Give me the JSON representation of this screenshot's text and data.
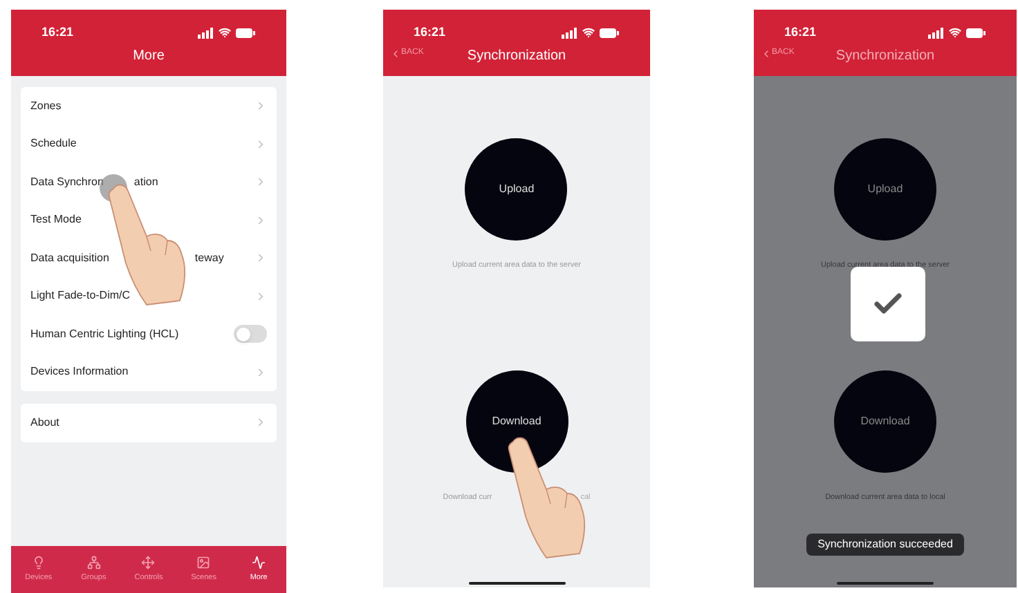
{
  "screens": [
    {
      "kind": "menu",
      "time": "16:21",
      "title": "More",
      "touch_hint": true,
      "sections": [
        {
          "rows": [
            {
              "kind": "link",
              "label": "Zones"
            },
            {
              "kind": "link",
              "label": "Schedule"
            },
            {
              "kind": "link",
              "label": "Data Synchron",
              "label_end": "ation"
            },
            {
              "kind": "link",
              "label": "Test Mode"
            },
            {
              "kind": "link",
              "label": "Data acquisition",
              "label_end": "teway"
            },
            {
              "kind": "link",
              "label": "Light Fade-to-Dim/C"
            },
            {
              "kind": "toggle",
              "label": "Human Centric Lighting (HCL)",
              "on": false
            },
            {
              "kind": "link",
              "label": "Devices Information"
            }
          ]
        },
        {
          "rows": [
            {
              "kind": "link",
              "label": "About"
            }
          ]
        }
      ],
      "tabs": [
        {
          "label": "Devices",
          "selected": false
        },
        {
          "label": "Groups",
          "selected": false
        },
        {
          "label": "Controls",
          "selected": false
        },
        {
          "label": "Scenes",
          "selected": false
        },
        {
          "label": "More",
          "selected": true
        }
      ]
    },
    {
      "kind": "sync",
      "time": "16:21",
      "back": "BACK",
      "title": "Synchronization",
      "touch_hint": true,
      "dimmed": false,
      "actions": [
        {
          "label": "Upload",
          "description": "Upload current area data to the server"
        },
        {
          "label": "Download",
          "description": "Download curr",
          "description_end": "cal"
        }
      ]
    },
    {
      "kind": "sync",
      "time": "16:21",
      "back": "BACK",
      "title": "Synchronization",
      "touch_hint": false,
      "dimmed": true,
      "success": true,
      "actions": [
        {
          "label": "Upload",
          "description": "Upload current area data to the server"
        },
        {
          "label": "Download",
          "description": "Download current area data to local"
        }
      ],
      "toast": "Synchronization succeeded"
    }
  ]
}
